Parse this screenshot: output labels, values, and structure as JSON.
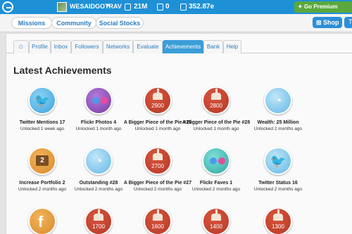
{
  "topbar": {
    "username": "WESAIDGOTRAV",
    "caret": "▼",
    "stat_cash": "21M",
    "stat_v": "0",
    "stat_worth": "352.87e",
    "premium_label": "Go Premium"
  },
  "subnav": {
    "items": [
      {
        "label": "Missions"
      },
      {
        "label": "Community"
      },
      {
        "label": "Social Stocks"
      }
    ],
    "shop_label": "Shop",
    "extra_label": "T"
  },
  "tabs": [
    {
      "label": ""
    },
    {
      "label": "Profile"
    },
    {
      "label": "Inbox"
    },
    {
      "label": "Followers"
    },
    {
      "label": "Networks"
    },
    {
      "label": "Evaluate"
    },
    {
      "label": "Achievements",
      "active": true
    },
    {
      "label": "Bank"
    },
    {
      "label": "Help"
    }
  ],
  "section_title": "Latest Achievements",
  "achievements": [
    {
      "title": "Twitter Mentions 17",
      "time": "Unlocked 1 week ago",
      "icon": "twitter-bird-icon",
      "color": "#3aa3dc"
    },
    {
      "title": "Flickr Photos 4",
      "time": "Unlocked 1 month ago",
      "icon": "flickr-icon",
      "color": "#7a3ea8"
    },
    {
      "title": "A Bigger Piece of the Pie #29",
      "time": "Unlocked 1 month ago",
      "icon": "cake-icon",
      "number": "2900",
      "color": "#b43a26"
    },
    {
      "title": "A Bigger Piece of the Pie #28",
      "time": "Unlocked 1 month ago",
      "icon": "cake-icon",
      "number": "2800",
      "color": "#b43a26"
    },
    {
      "title": "Wealth: 25 Million",
      "time": "Unlocked 2 months ago",
      "icon": "wealth-icon",
      "color": "#62b7e6"
    },
    {
      "title": "Increase Portfolio 2",
      "time": "Unlocked 2 months ago",
      "icon": "briefcase-icon",
      "number": "2",
      "color": "#d98a2a"
    },
    {
      "title": "Outstanding #28",
      "time": "Unlocked 2 months ago",
      "icon": "outstanding-icon",
      "color": "#62b7e6"
    },
    {
      "title": "A Bigger Piece of the Pie #27",
      "time": "Unlocked 2 months ago",
      "icon": "cake-icon",
      "number": "2700",
      "color": "#b43a26"
    },
    {
      "title": "Flickr Faves 1",
      "time": "Unlocked 2 months ago",
      "icon": "flickr-icon",
      "color": "#2ea8a2"
    },
    {
      "title": "Twitter Status 16",
      "time": "Unlocked 2 months ago",
      "icon": "twitter-bird-icon",
      "color": "#62b7e6"
    },
    {
      "title": "",
      "time": "",
      "icon": "facebook-icon",
      "color": "#d98a2a"
    },
    {
      "title": "",
      "time": "",
      "icon": "cake-icon",
      "number": "1700",
      "color": "#b43a26"
    },
    {
      "title": "",
      "time": "",
      "icon": "cake-icon",
      "number": "1600",
      "color": "#b43a26"
    },
    {
      "title": "",
      "time": "",
      "icon": "cake-icon",
      "number": "1400",
      "color": "#b43a26"
    },
    {
      "title": "",
      "time": "",
      "icon": "cake-icon",
      "number": "1300",
      "color": "#b43a26"
    }
  ]
}
